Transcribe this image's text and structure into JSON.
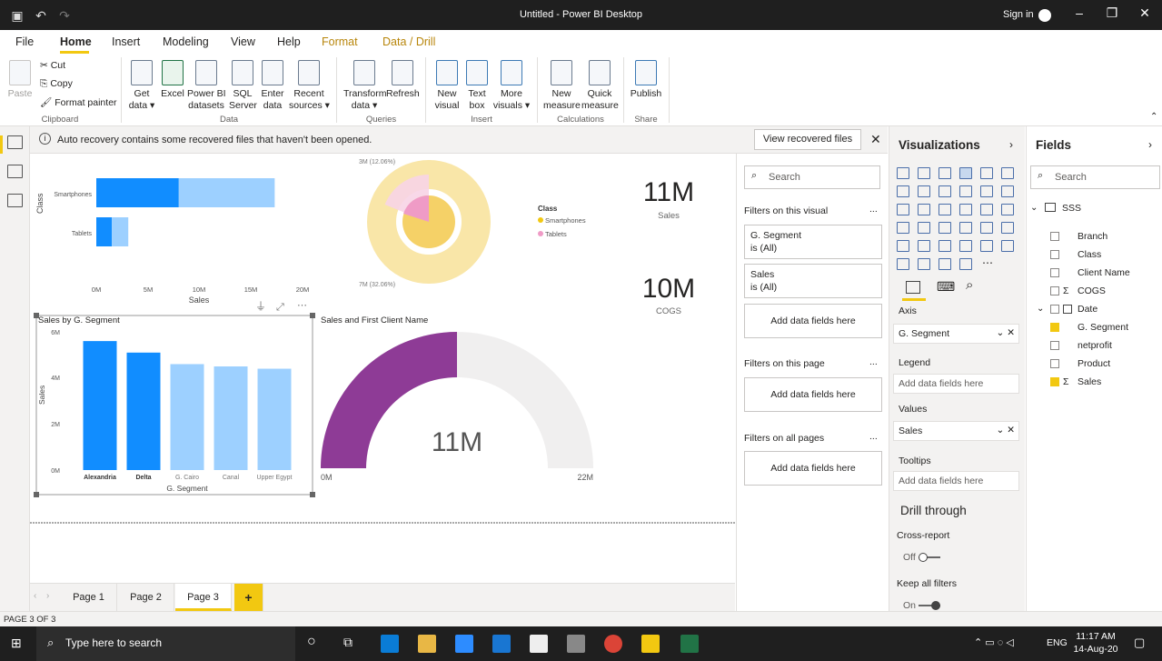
{
  "window": {
    "title": "Untitled - Power BI Desktop",
    "signin": "Sign in"
  },
  "tabs": [
    "File",
    "Home",
    "Insert",
    "Modeling",
    "View",
    "Help",
    "Format",
    "Data / Drill"
  ],
  "ribbon": {
    "paste": "Paste",
    "cut": "Cut",
    "copy": "Copy",
    "format_painter": "Format painter",
    "get_data": "Get\ndata ▾",
    "excel": "Excel",
    "pbi_datasets": "Power BI\ndatasets",
    "sql": "SQL\nServer",
    "enter_data": "Enter\ndata",
    "recent": "Recent\nsources ▾",
    "transform": "Transform\ndata ▾",
    "refresh": "Refresh",
    "new_visual": "New\nvisual",
    "text_box": "Text\nbox",
    "more_visuals": "More\nvisuals ▾",
    "new_measure": "New\nmeasure",
    "quick_measure": "Quick\nmeasure",
    "publish": "Publish",
    "groups": {
      "clipboard": "Clipboard",
      "data": "Data",
      "queries": "Queries",
      "insert": "Insert",
      "calculations": "Calculations",
      "share": "Share"
    }
  },
  "notification": {
    "text": "Auto recovery contains some recovered files that haven't been opened.",
    "button": "View recovered files"
  },
  "visuals": {
    "class_bar": {
      "ylabel": "Class",
      "xlabel": "Sales",
      "categories": [
        "Smartphones",
        "Tablets"
      ],
      "ticks": [
        "0M",
        "5M",
        "10M",
        "15M",
        "20M"
      ]
    },
    "donut": {
      "label_top": "3M (12.06%)",
      "label_bottom": "7M (32.06%)",
      "legend_title": "Class",
      "legend": [
        "Smartphones",
        "Tablets"
      ]
    },
    "card_sales": {
      "value": "11M",
      "label": "Sales"
    },
    "card_cogs": {
      "value": "10M",
      "label": "COGS"
    },
    "seg_bar": {
      "title": "Sales by G. Segment",
      "ylabel": "Sales",
      "xlabel": "G. Segment",
      "yticks": [
        "6M",
        "4M",
        "2M",
        "0M"
      ],
      "categories": [
        "Alexandria",
        "Delta",
        "G. Cairo",
        "Canal",
        "Upper Egypt"
      ]
    },
    "gauge": {
      "title": "Sales and First Client Name",
      "value": "11M",
      "min": "0M",
      "max": "22M"
    }
  },
  "chart_data": [
    {
      "type": "bar",
      "orientation": "horizontal",
      "categories": [
        "Smartphones",
        "Tablets"
      ],
      "series": [
        {
          "values": [
            8.0,
            1.5
          ]
        },
        {
          "values": [
            9.3,
            1.6
          ]
        }
      ],
      "xlabel": "Sales",
      "ylabel": "Class",
      "xlim": [
        0,
        20
      ]
    },
    {
      "type": "bar",
      "categories": [
        "Alexandria",
        "Delta",
        "G. Cairo",
        "Canal",
        "Upper Egypt"
      ],
      "values": [
        5.6,
        5.1,
        4.6,
        4.5,
        4.4
      ],
      "title": "Sales by G. Segment",
      "xlabel": "G. Segment",
      "ylabel": "Sales",
      "ylim": [
        0,
        6
      ]
    },
    {
      "type": "gauge",
      "value": 11,
      "min": 0,
      "max": 22,
      "title": "Sales and First Client Name"
    }
  ],
  "filters": {
    "search": "Search",
    "on_visual": "Filters on this visual",
    "seg_field": "G. Segment",
    "seg_val": "is (All)",
    "sales_field": "Sales",
    "sales_val": "is (All)",
    "add": "Add data fields here",
    "on_page": "Filters on this page",
    "all_pages": "Filters on all pages",
    "more": "..."
  },
  "viz": {
    "title": "Visualizations",
    "axis": "Axis",
    "axis_val": "G. Segment",
    "legend": "Legend",
    "legend_val": "Add data fields here",
    "values": "Values",
    "values_val": "Sales",
    "tooltips": "Tooltips",
    "tooltips_val": "Add data fields here",
    "drill": "Drill through",
    "cross": "Cross-report",
    "off": "Off",
    "keep": "Keep all filters",
    "on": "On"
  },
  "fields": {
    "title": "Fields",
    "search": "Search",
    "table": "SSS",
    "items": [
      "Branch",
      "Class",
      "Client Name",
      "COGS",
      "Date",
      "G. Segment",
      "netprofit",
      "Product",
      "Sales"
    ]
  },
  "pages": [
    "Page 1",
    "Page 2",
    "Page 3",
    "+"
  ],
  "status": "PAGE 3 OF 3",
  "taskbar": {
    "search": "Type here to search",
    "time": "11:17 AM",
    "date": "14-Aug-20",
    "lang": "ENG"
  },
  "colors": {
    "dark_blue": "#118dff",
    "light_blue": "#9dd0ff",
    "purple": "#8e3b96",
    "yellow": "#f2c811"
  }
}
